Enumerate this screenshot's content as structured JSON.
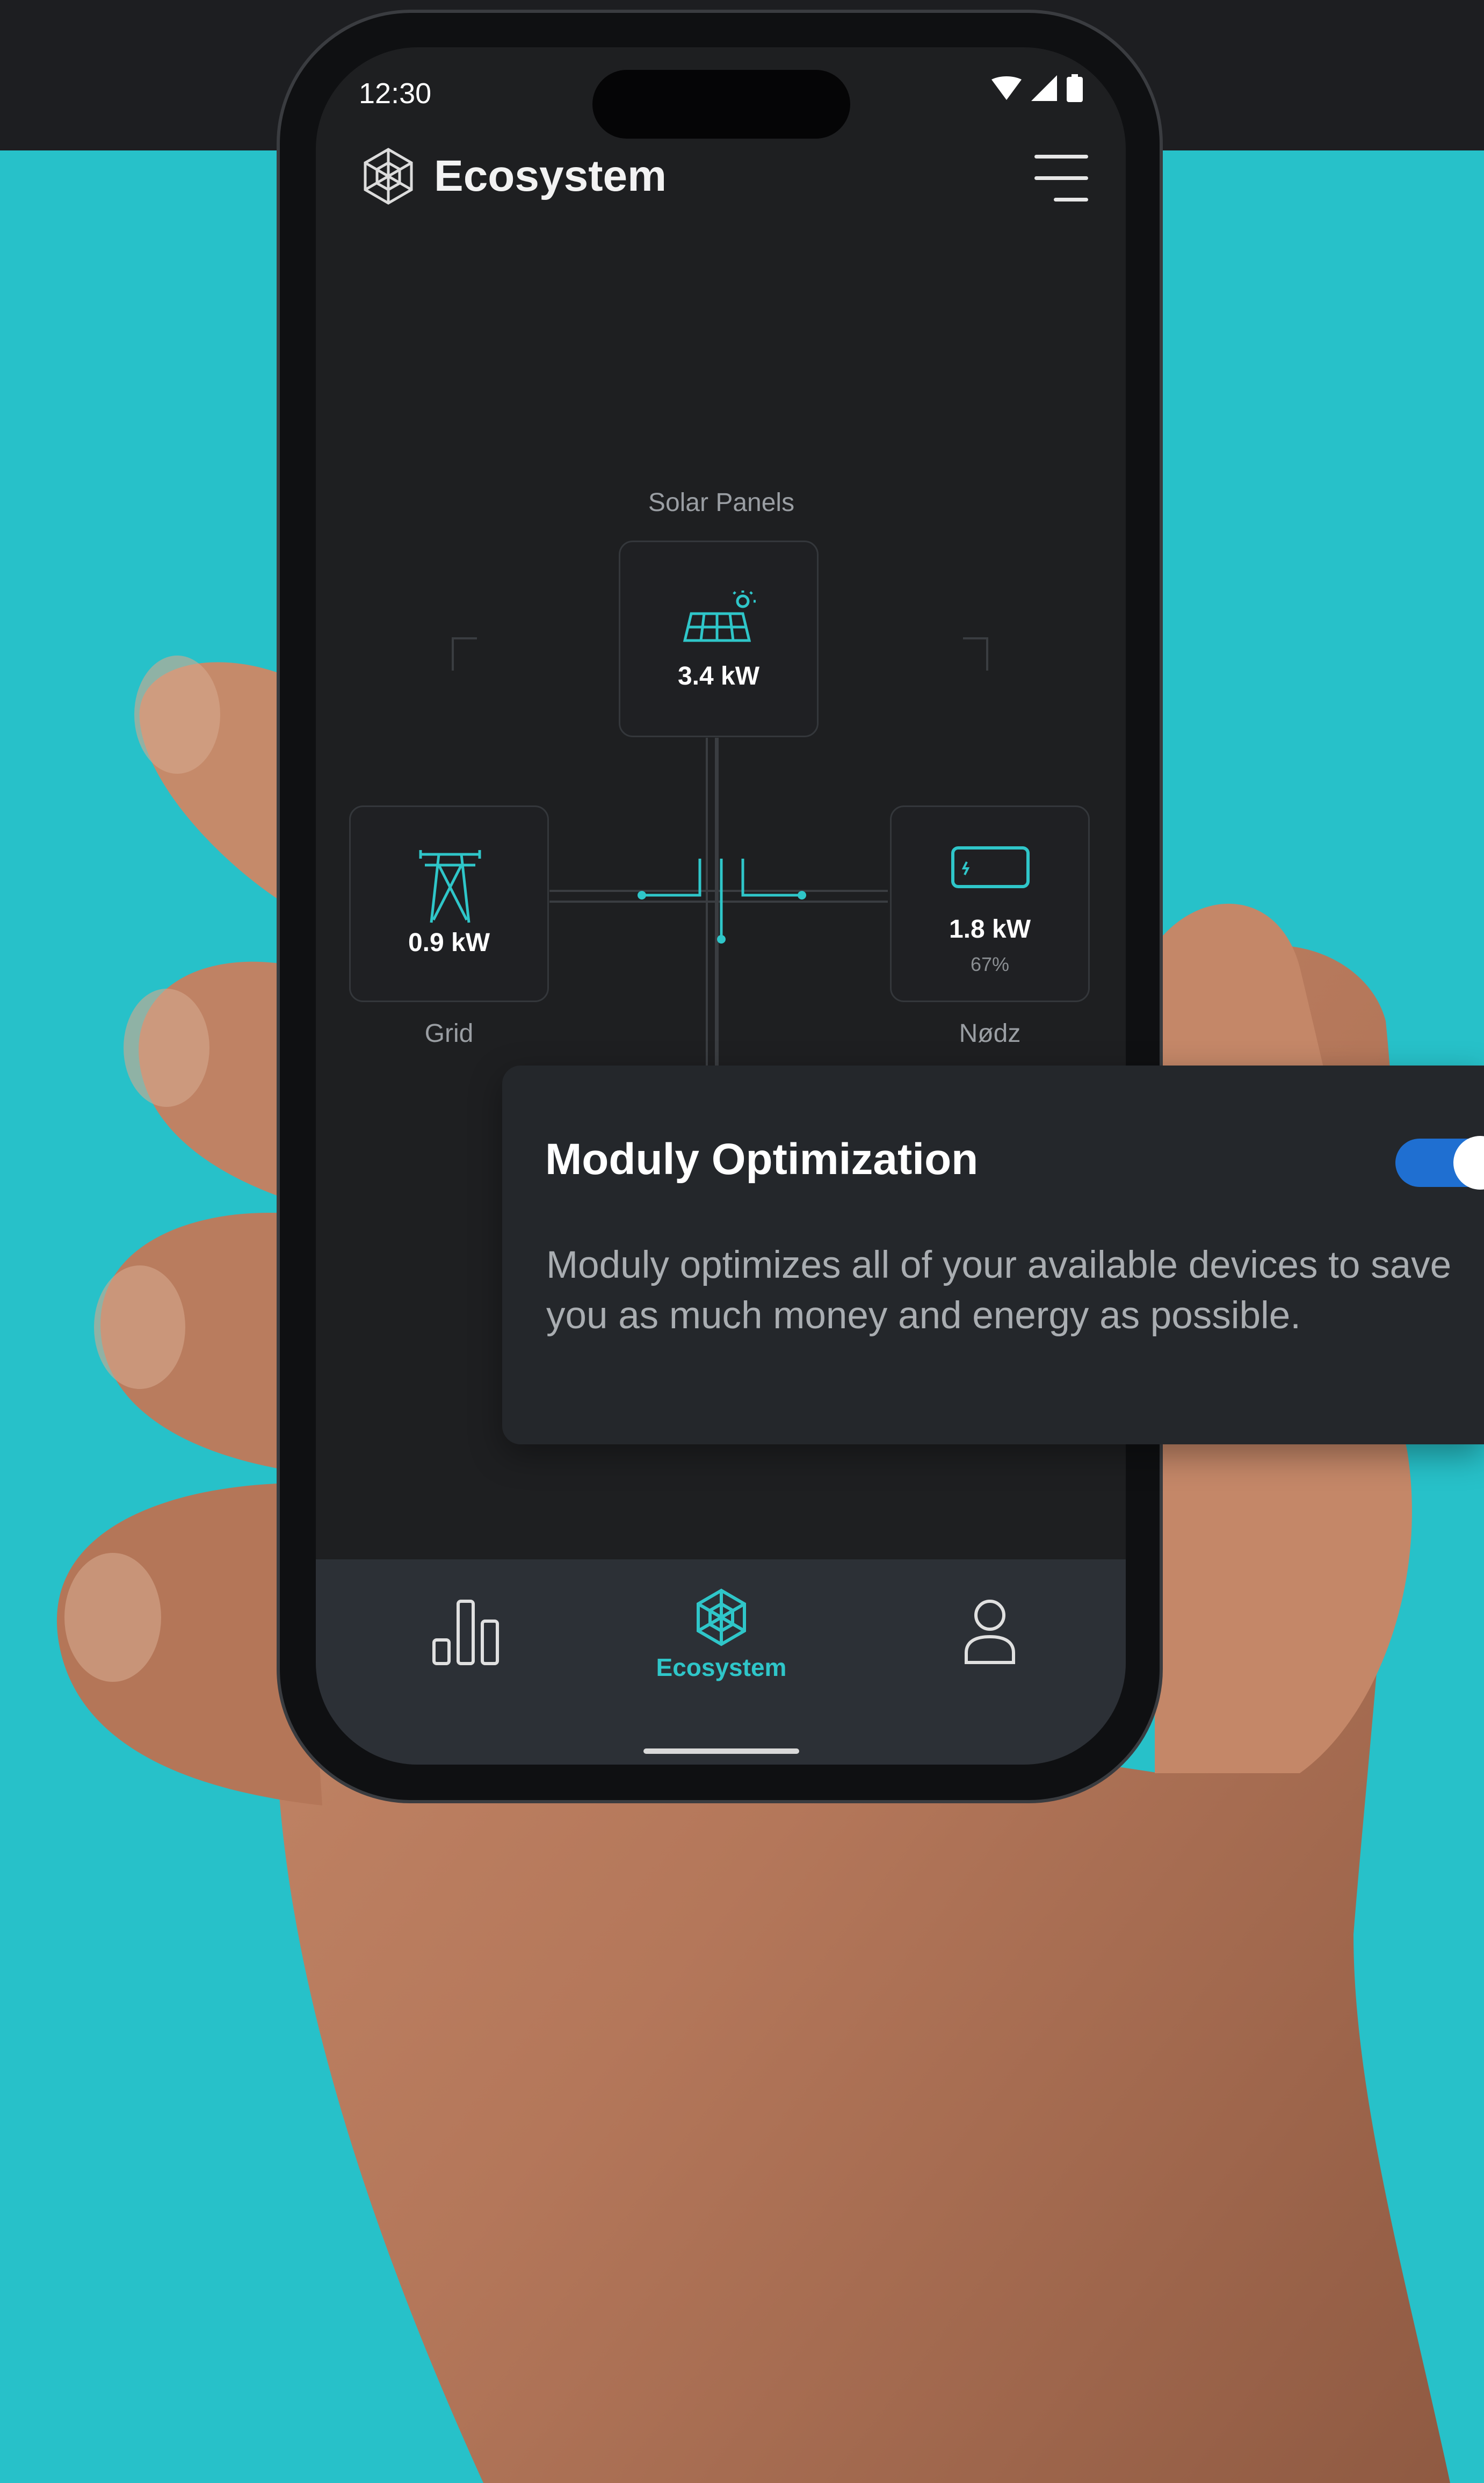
{
  "status_bar": {
    "time": "12:30"
  },
  "app": {
    "title": "Ecosystem"
  },
  "diagram": {
    "solar": {
      "label": "Solar Panels",
      "value": "3.4 kW"
    },
    "grid": {
      "label": "Grid",
      "value": "0.9 kW"
    },
    "battery": {
      "label": "Nødz",
      "value": "1.8 kW",
      "percent": "67%"
    }
  },
  "card": {
    "title": "Moduly Optimization",
    "description": "Moduly optimizes all of your available devices to save you as much money and energy as possible.",
    "toggle_on": true
  },
  "bottom_nav": {
    "items": [
      {
        "icon": "bar-chart-icon",
        "label": ""
      },
      {
        "icon": "ecosystem-icon",
        "label": "Ecosystem",
        "active": true
      },
      {
        "icon": "profile-icon",
        "label": ""
      }
    ]
  },
  "colors": {
    "background": "#27c1c9",
    "accent": "#2fc6c9",
    "toggle": "#1f6fd1",
    "screen": "#1e1f21"
  }
}
